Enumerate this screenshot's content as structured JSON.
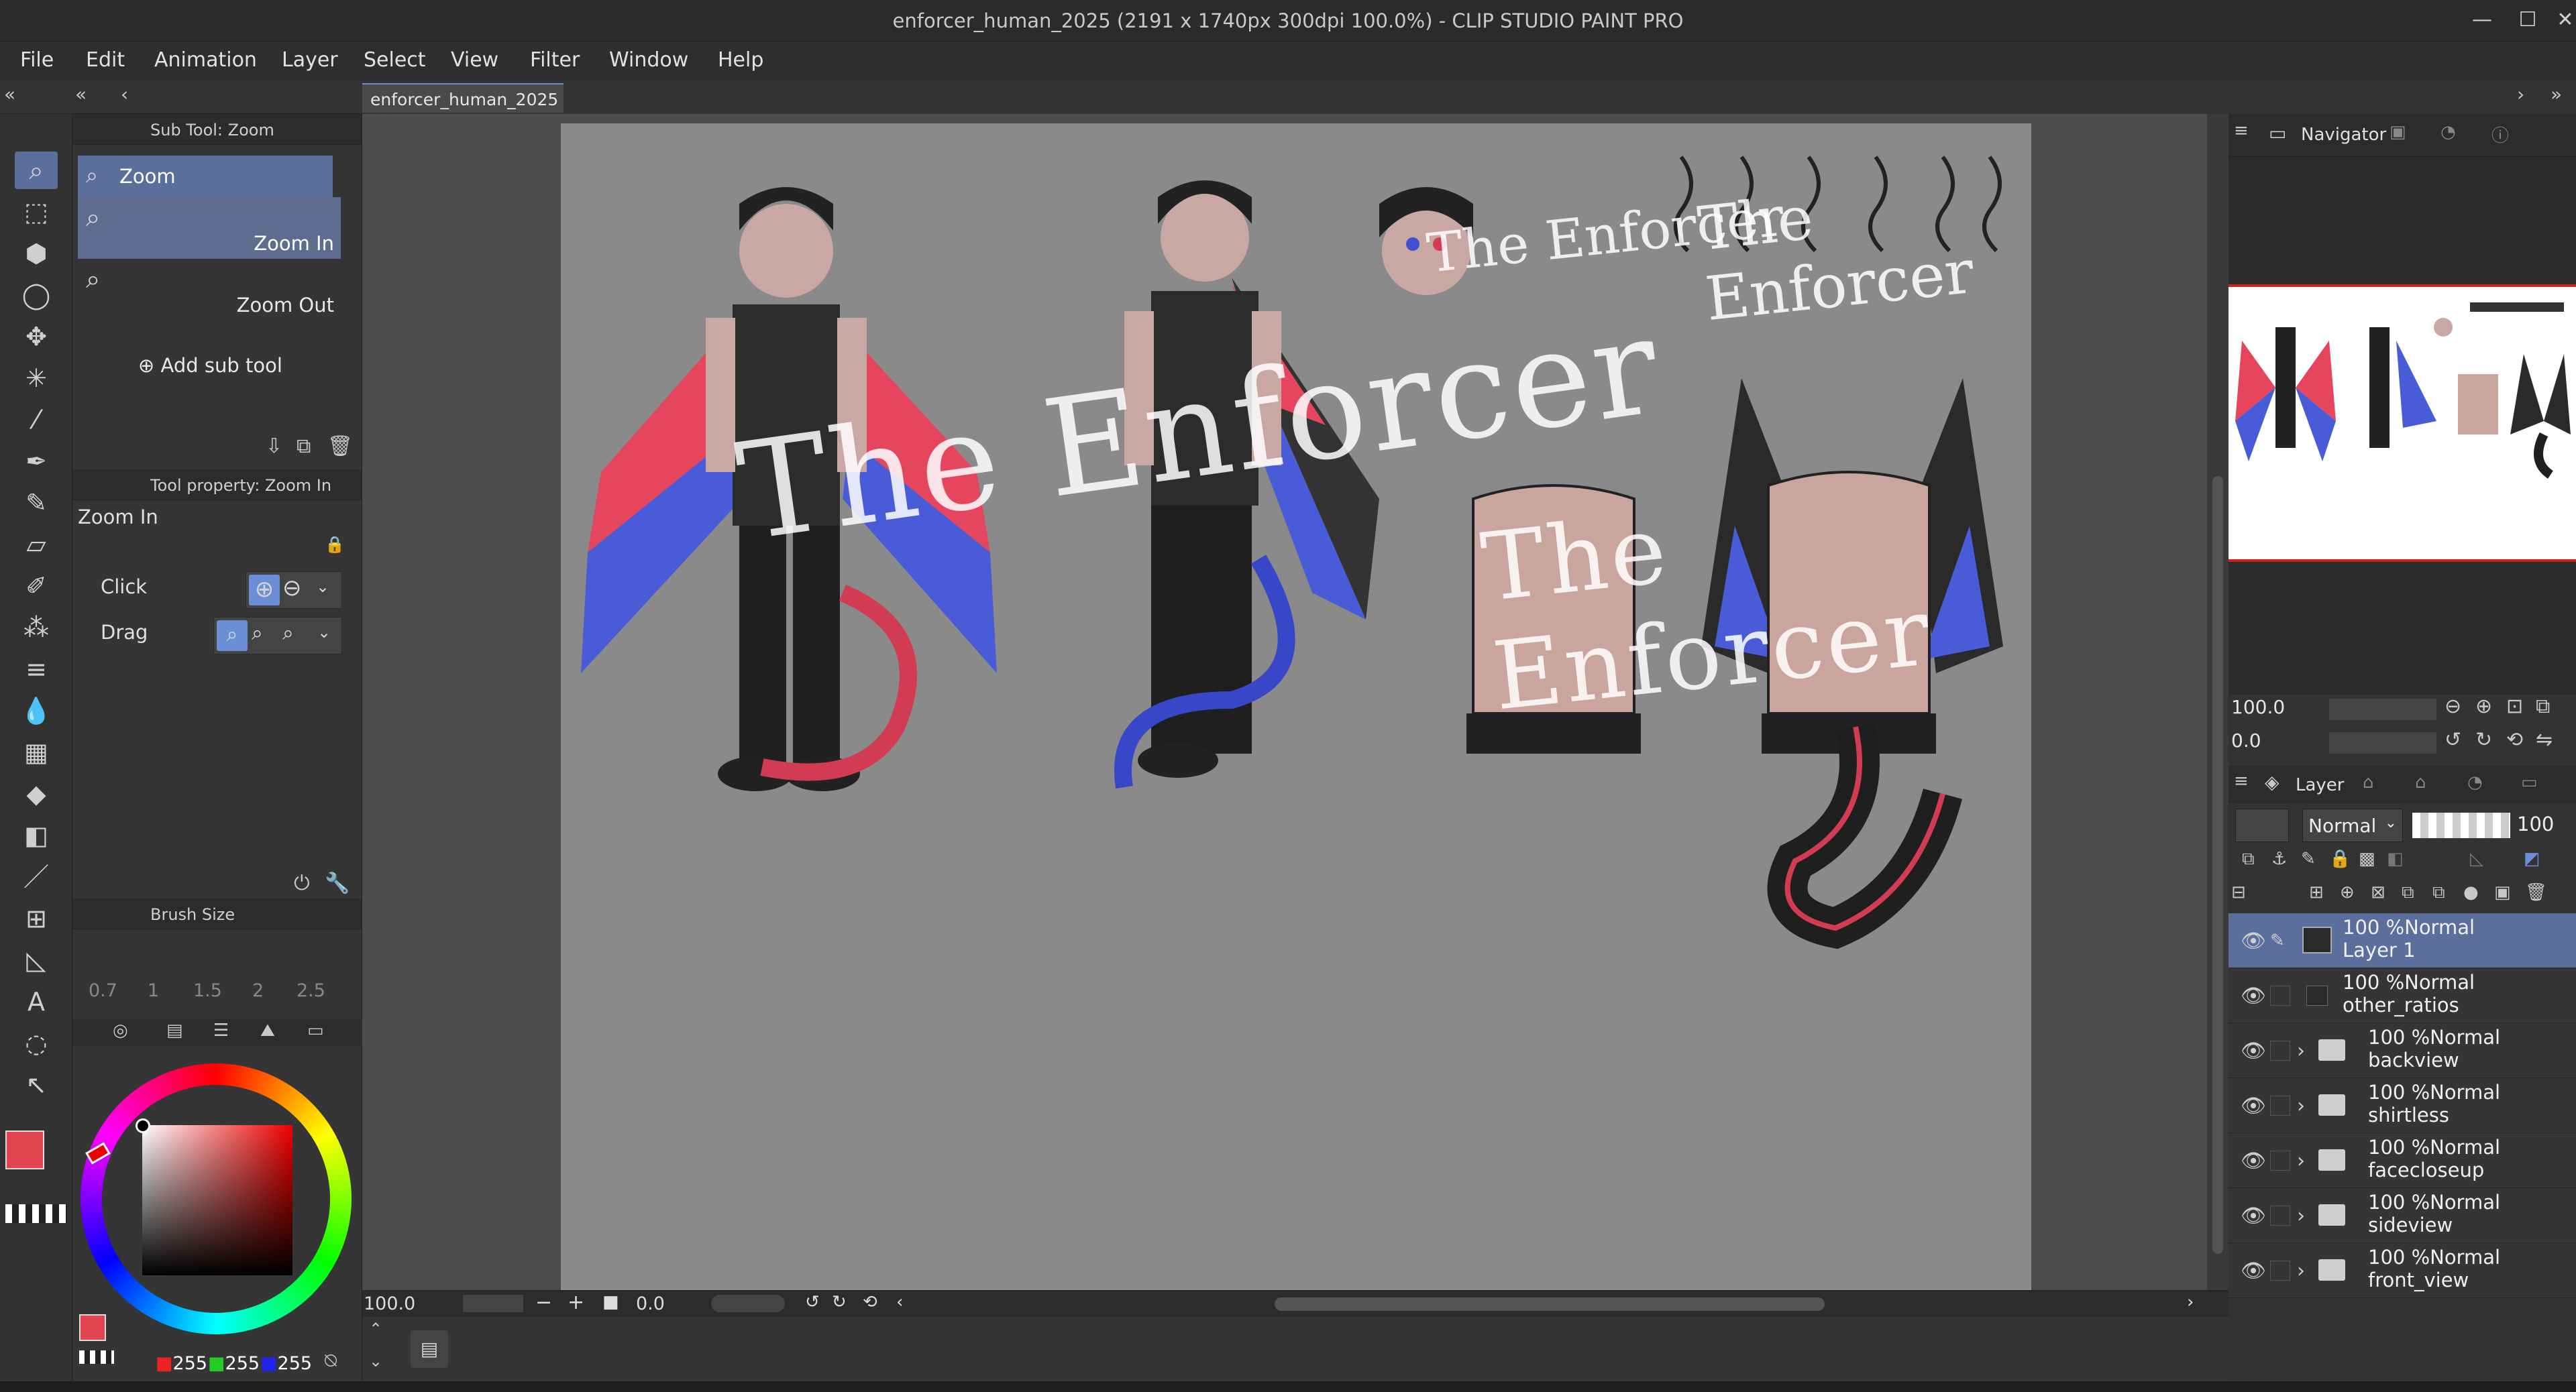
{
  "window": {
    "title": "enforcer_human_2025 (2191 x 1740px 300dpi 100.0%)  - CLIP STUDIO PAINT PRO",
    "minimize": "—",
    "maximize": "☐",
    "close": "✕"
  },
  "menu": [
    "File",
    "Edit",
    "Animation",
    "Layer",
    "Select",
    "View",
    "Filter",
    "Window",
    "Help"
  ],
  "document_tab": {
    "label": "enforcer_human_2025",
    "close": "✕"
  },
  "sub_tool": {
    "header": "Sub Tool: Zoom",
    "group": "Zoom",
    "items": [
      {
        "label": "Zoom In"
      },
      {
        "label": "Zoom Out"
      }
    ],
    "add_label": "Add sub tool"
  },
  "tool_property": {
    "header": "Tool property: Zoom In",
    "tool_name": "Zoom In",
    "click_label": "Click",
    "drag_label": "Drag"
  },
  "brush_size": {
    "header": "Brush Size",
    "sizes": [
      "0.7",
      "1",
      "1.5",
      "2",
      "2.5"
    ]
  },
  "color": {
    "main": "#e0454f",
    "sub": "#ffffff",
    "r": "255",
    "g": "255",
    "b": "255"
  },
  "canvas": {
    "watermark": "The Enforcer",
    "zoom": "100.0",
    "angle": "0.0"
  },
  "navigator": {
    "header": "Navigator",
    "zoom": "100.0",
    "angle": "0.0"
  },
  "layer_panel": {
    "header": "Layer",
    "blend_mode": "Normal",
    "opacity": "100",
    "layers": [
      {
        "mode": "100 %Normal",
        "name": "Layer 1",
        "type": "raster",
        "selected": true
      },
      {
        "mode": "100 %Normal",
        "name": "other_ratios",
        "type": "raster",
        "selected": false
      },
      {
        "mode": "100 %Normal",
        "name": "backview",
        "type": "folder",
        "selected": false
      },
      {
        "mode": "100 %Normal",
        "name": "shirtless",
        "type": "folder",
        "selected": false
      },
      {
        "mode": "100 %Normal",
        "name": "facecloseup",
        "type": "folder",
        "selected": false
      },
      {
        "mode": "100 %Normal",
        "name": "sideview",
        "type": "folder",
        "selected": false
      },
      {
        "mode": "100 %Normal",
        "name": "front_view",
        "type": "folder",
        "selected": false
      }
    ]
  },
  "icons": {
    "eye": "eye-icon",
    "pen": "pen-icon",
    "folder": "folder-icon",
    "chevron": "chevron-right-icon",
    "zoom": "magnifier-icon"
  }
}
